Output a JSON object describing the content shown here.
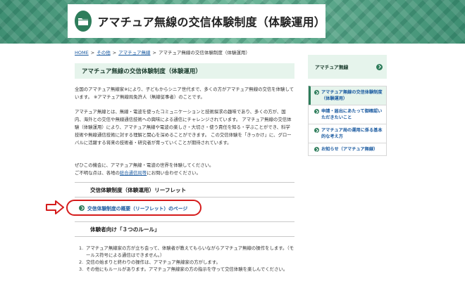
{
  "header": {
    "title": "アマチュア無線の交信体験制度（体験運用）",
    "icon": "folder-icon",
    "colors": {
      "banner": "#4a9a7c",
      "accent": "#2e7d5b"
    }
  },
  "breadcrumb": {
    "items": [
      "HOME",
      "その他",
      "アマチュア無線",
      "アマチュア無線の交信体験制度（体験運用）"
    ],
    "separator": ">"
  },
  "main": {
    "heading": "アマチュア無線の交信体験制度（体験運用）",
    "paragraph1": "全国のアマチュア無線家※により、子どもからシニア世代まで、多くの方がアマチュア無線の交信を体験しています。 ※アマチュア無線局免許人（無線従事者）のことです。",
    "paragraph2": "アマチュア無線とは、無線・電波を使ったコミュニケーションと技術探求の趣味であり、多くの方が、国内、海外との交信や無線通信技術への興味による通信にチャレンジされています。 アマチュア無線の交信体験（体験運用）により、アマチュア無線や電波の楽しさ・大切さ・使う責任を知る・学ぶことができ、科学技術や無線通信技術に対する理解と関心を深めることができます。 この交信体験を「きっかけ」に、グローバルに活躍する将来の技術者・研究者が育っていくことが期待されています。",
    "paragraph3_line1": "ぜひこの機会に、アマチュア無線・電波の世界を体験してください。",
    "paragraph3_prefix": "ご不明な点は、各地の",
    "paragraph3_link": "総合通信局等",
    "paragraph3_suffix": "にお問い合わせください。",
    "section_leaflet": "交信体験制度（体験運用）リーフレット",
    "leaflet_link": "交信体験制度の概要（リーフレット）のページ",
    "section_rules": "体験者向け「３つのルール」",
    "rules": [
      {
        "num": "1.",
        "text": "アマチュア無線家の方が立ち会って、体験者が教えてもらいながらアマチュア無線の操作をします。（モールス符号による通信はできません。）"
      },
      {
        "num": "2.",
        "text": "交信の始まりと終わりの操作は、アマチュア無線家の方がします。"
      },
      {
        "num": "3.",
        "text": "その他にもルールがあります。アマチュア無線家の方の指示を守って交信体験を楽しんでください。"
      }
    ]
  },
  "sidebar": {
    "heading": "アマチュア無線",
    "items": [
      {
        "label": "アマチュア無線の交信体験制度（体験運用）",
        "active": true
      },
      {
        "label": "申請・届出にあたって御確認いただきたいこと",
        "active": false
      },
      {
        "label": "アマチュア局の運用に係る基本的な考え方",
        "active": false
      },
      {
        "label": "お知らせ（アマチュア無線）",
        "active": false
      }
    ]
  },
  "annotation": {
    "color": "#d51c1c"
  }
}
